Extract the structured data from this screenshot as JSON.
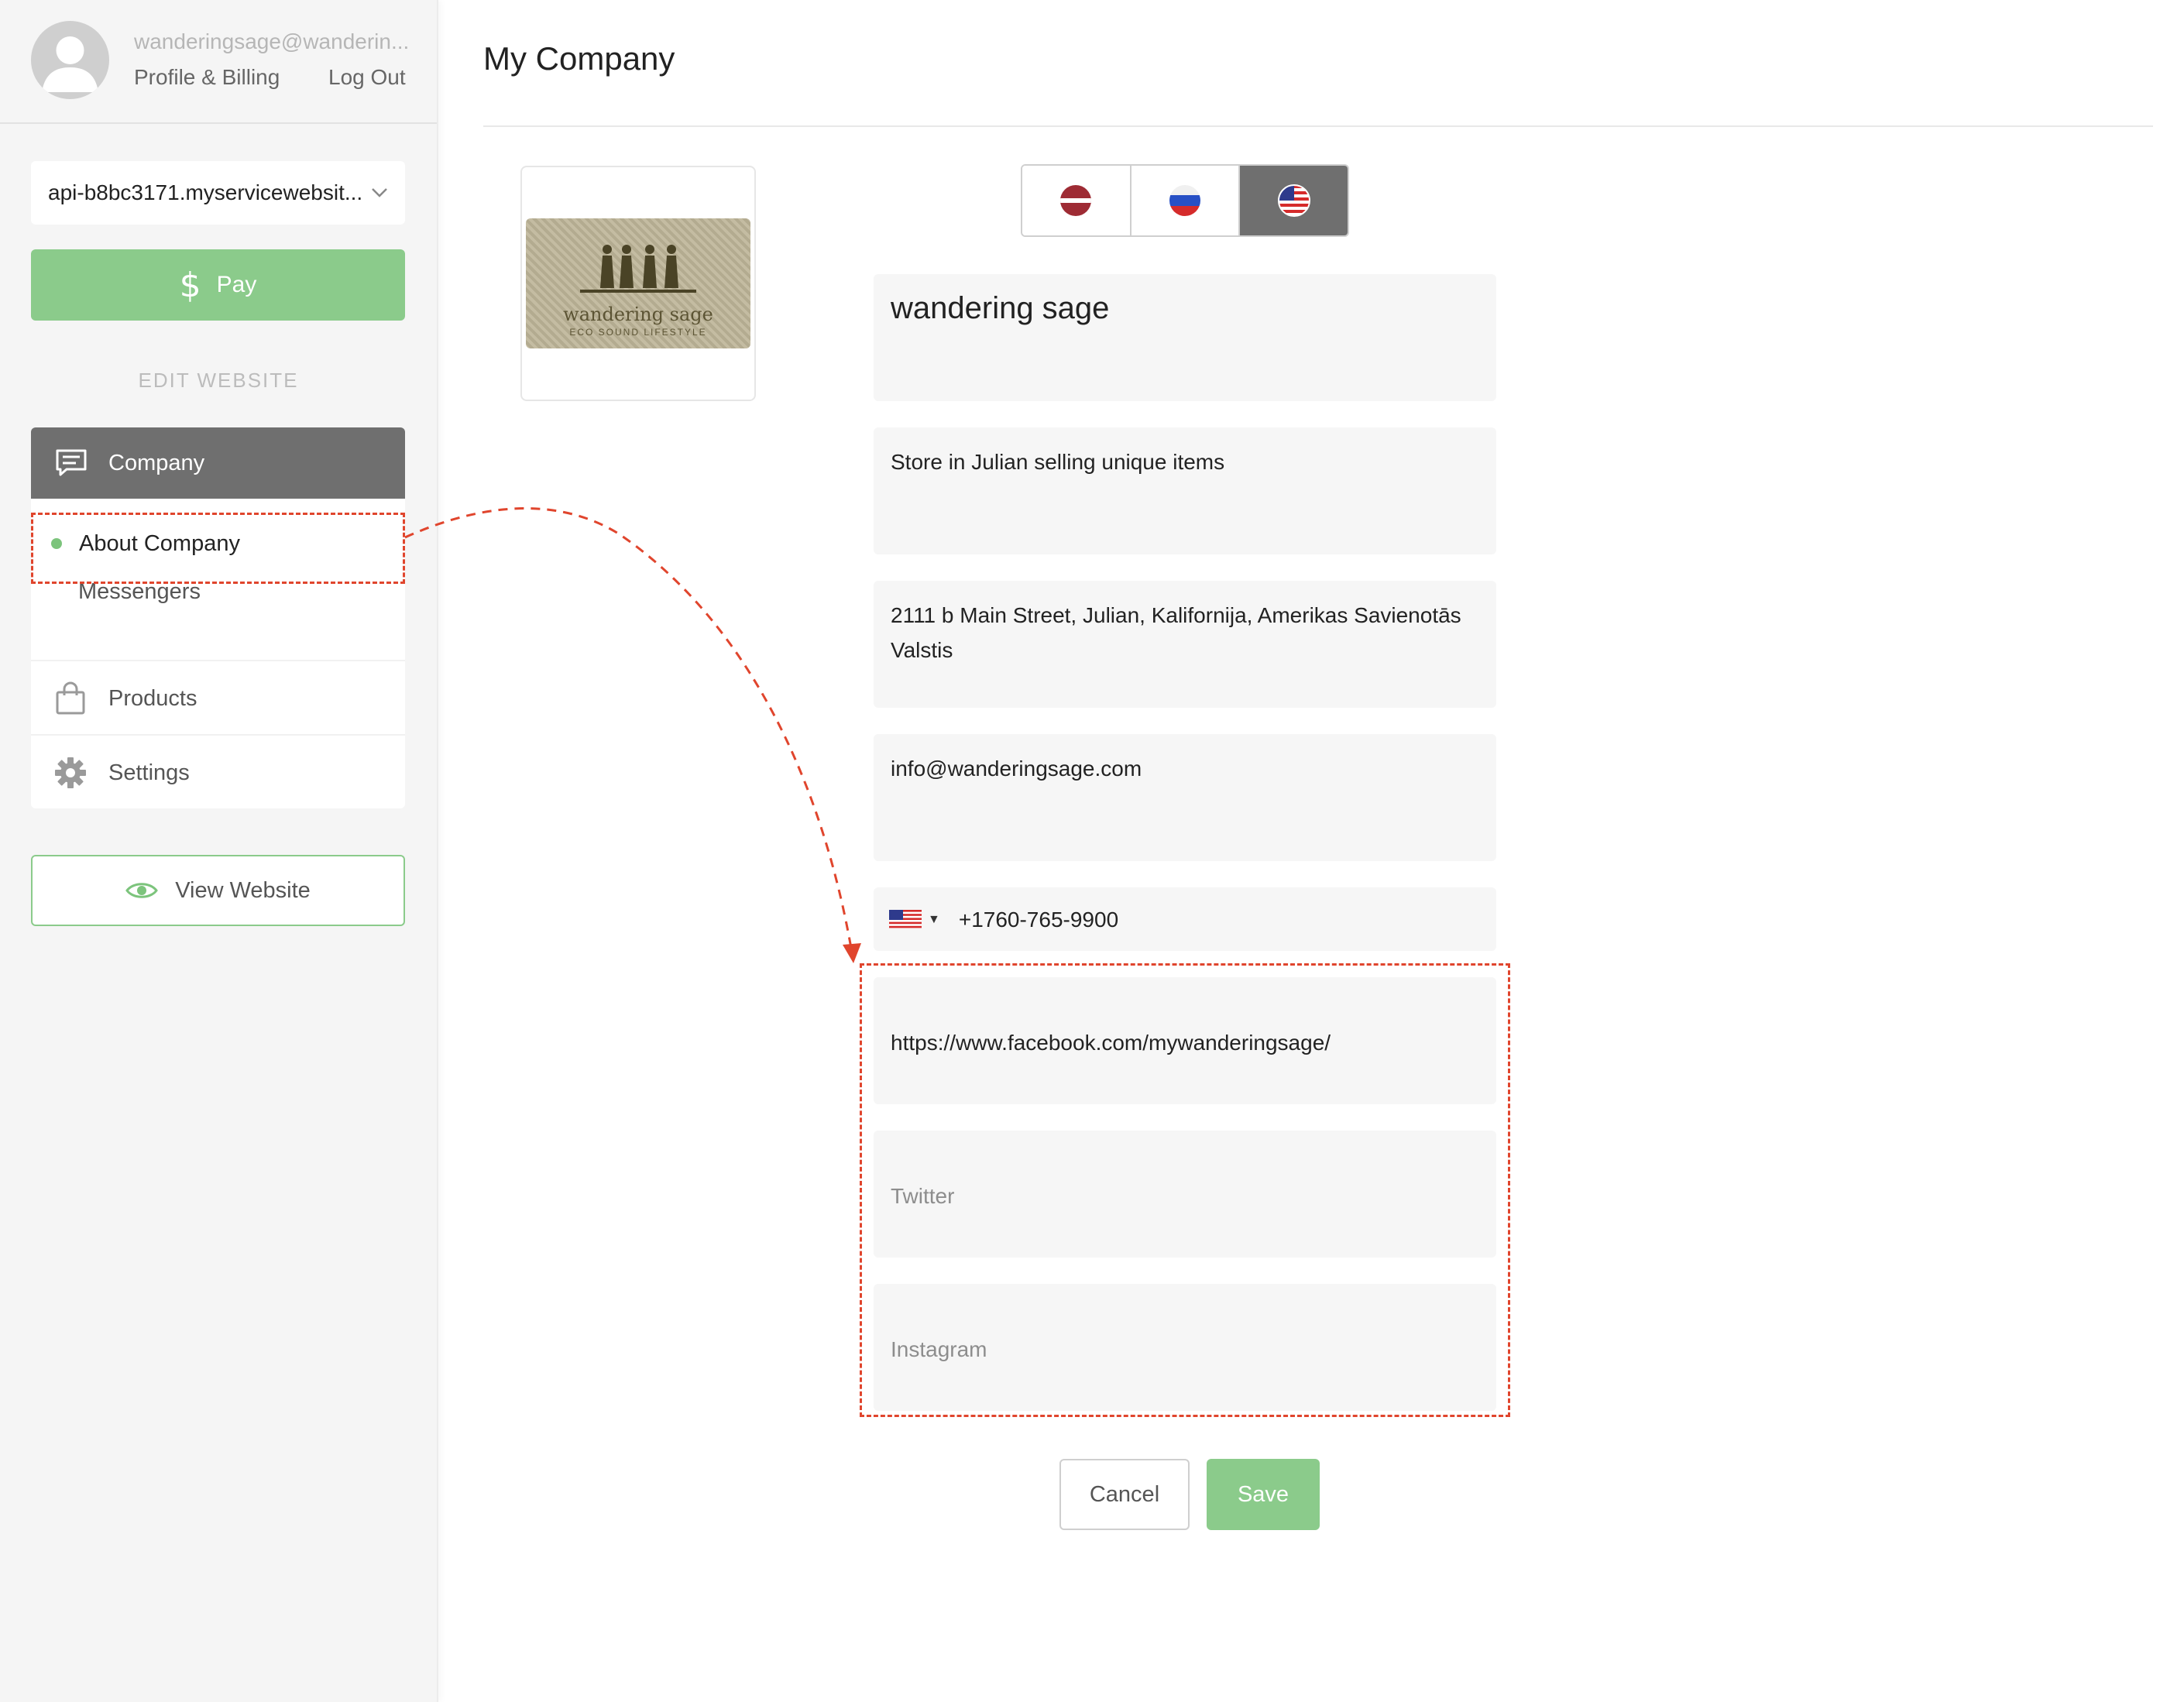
{
  "user": {
    "email": "wanderingsage@wanderin...",
    "profile_link": "Profile & Billing",
    "logout_link": "Log Out"
  },
  "site_selector": {
    "value": "api-b8bc3171.myservicewebsit..."
  },
  "pay_button": {
    "label": "Pay",
    "icon": "dollar-icon"
  },
  "section_title": "EDIT WEBSITE",
  "nav": {
    "company": {
      "label": "Company",
      "icon": "chat-icon"
    },
    "sub_items": [
      {
        "label": "About Company",
        "active": true
      },
      {
        "label": "Messengers",
        "active": false
      }
    ],
    "products": {
      "label": "Products",
      "icon": "shopping-bag-icon"
    },
    "settings": {
      "label": "Settings",
      "icon": "gear-icon"
    }
  },
  "view_website_button": {
    "label": "View Website",
    "icon": "eye-icon"
  },
  "main": {
    "title": "My Company",
    "logo": {
      "text": "wandering sage",
      "tagline": "ECO SOUND LIFESTYLE"
    },
    "languages": [
      {
        "code": "lv",
        "icon": "latvia-flag-icon",
        "active": false
      },
      {
        "code": "ru",
        "icon": "russia-flag-icon",
        "active": false
      },
      {
        "code": "en",
        "icon": "usa-flag-icon",
        "active": true
      }
    ],
    "fields": {
      "name": "wandering sage",
      "description": "Store in Julian selling unique items",
      "address": "2111 b Main Street, Julian, Kalifornija, Amerikas Savienotās Valstis",
      "email": "info@wanderingsage.com",
      "phone": {
        "country": "us",
        "value": "+1760-765-9900"
      },
      "facebook": "https://www.facebook.com/mywanderingsage/",
      "twitter_placeholder": "Twitter",
      "instagram_placeholder": "Instagram"
    },
    "cancel_label": "Cancel",
    "save_label": "Save"
  },
  "colors": {
    "accent_green": "#8bcb8b",
    "active_nav": "#6f6f6f",
    "annotation_red": "#e0452d"
  }
}
